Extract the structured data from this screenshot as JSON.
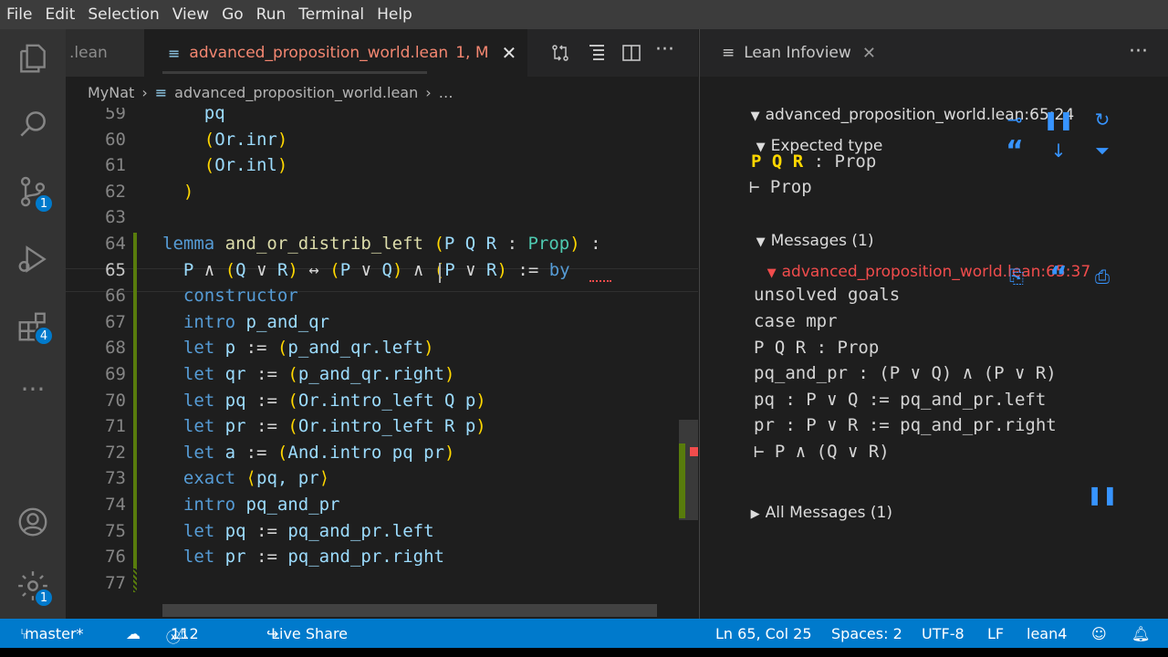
{
  "menu": [
    "File",
    "Edit",
    "Selection",
    "View",
    "Go",
    "Run",
    "Terminal",
    "Help"
  ],
  "activity": {
    "scm_badge": "1",
    "extensions_badge": "4",
    "settings_badge": "1"
  },
  "tabs": {
    "prev": ".lean",
    "active": "advanced_proposition_world.lean",
    "active_status": "1, M"
  },
  "breadcrumb": {
    "folder": "MyNat",
    "file": "advanced_proposition_world.lean",
    "more": "…"
  },
  "code_lines": [
    {
      "n": "59",
      "html": "    <span class='vr'>pq</span>"
    },
    {
      "n": "60",
      "html": "    <span class='br'>(</span><span class='vr'>Or.inr</span><span class='br'>)</span>"
    },
    {
      "n": "61",
      "html": "    <span class='br'>(</span><span class='vr'>Or.inl</span><span class='br'>)</span>"
    },
    {
      "n": "62",
      "html": "  <span class='br'>)</span>"
    },
    {
      "n": "63",
      "html": ""
    },
    {
      "n": "64",
      "html": "<span class='kw'>lemma</span> <span class='fn'>and_or_distrib_left</span> <span class='br'>(</span><span class='vr'>P Q R</span> <span class='pl'>:</span> <span class='ty'>Prop</span><span class='br'>)</span> <span class='pl'>:</span>"
    },
    {
      "n": "65",
      "html": "  <span class='vr'>P</span> <span class='pl'>∧</span> <span class='br'>(</span><span class='vr'>Q</span> <span class='pl'>∨</span> <span class='vr'>R</span><span class='br'>)</span> <span class='pl'>↔</span> <span class='br'>(</span><span class='vr'>P</span> <span class='pl'>∨</span> <span class='vr'>Q</span><span class='br'>)</span> <span class='pl'>∧</span> <span class='br'>(</span><span class='vr'>P</span> <span class='pl'>∨</span> <span class='vr'>R</span><span class='br'>)</span> <span class='pl'>:=</span> <span class='kw'>by</span>"
    },
    {
      "n": "66",
      "html": "  <span class='kw'>constructor</span>"
    },
    {
      "n": "67",
      "html": "  <span class='kw'>intro</span> <span class='vr'>p_and_qr</span>"
    },
    {
      "n": "68",
      "html": "  <span class='kw'>let</span> <span class='vr'>p</span> <span class='pl'>:=</span> <span class='br'>(</span><span class='vr'>p_and_qr.left</span><span class='br'>)</span>"
    },
    {
      "n": "69",
      "html": "  <span class='kw'>let</span> <span class='vr'>qr</span> <span class='pl'>:=</span> <span class='br'>(</span><span class='vr'>p_and_qr.right</span><span class='br'>)</span>"
    },
    {
      "n": "70",
      "html": "  <span class='kw'>let</span> <span class='vr'>pq</span> <span class='pl'>:=</span> <span class='br'>(</span><span class='vr'>Or.intro_left Q p</span><span class='br'>)</span>"
    },
    {
      "n": "71",
      "html": "  <span class='kw'>let</span> <span class='vr'>pr</span> <span class='pl'>:=</span> <span class='br'>(</span><span class='vr'>Or.intro_left R p</span><span class='br'>)</span>"
    },
    {
      "n": "72",
      "html": "  <span class='kw'>let</span> <span class='vr'>a</span> <span class='pl'>:=</span> <span class='br'>(</span><span class='vr'>And.intro pq pr</span><span class='br'>)</span>"
    },
    {
      "n": "73",
      "html": "  <span class='kw'>exact</span> <span class='br'>⟨</span><span class='vr'>pq, pr</span><span class='br'>⟩</span>"
    },
    {
      "n": "74",
      "html": "  <span class='kw'>intro</span> <span class='vr'>pq_and_pr</span>"
    },
    {
      "n": "75",
      "html": "  <span class='kw'>let</span> <span class='vr'>pq</span> <span class='pl'>:=</span> <span class='vr'>pq_and_pr.left</span>"
    },
    {
      "n": "76",
      "html": "  <span class='kw'>let</span> <span class='vr'>pr</span> <span class='pl'>:=</span> <span class='vr'>pq_and_pr.right</span>"
    },
    {
      "n": "77",
      "html": ""
    }
  ],
  "infoview": {
    "title": "Lean Infoview",
    "location": "advanced_proposition_world.lean:65:24",
    "expected_type": "Expected type",
    "goal_vars": "P Q R",
    "goal_vars_type": ": Prop",
    "goal_target": "⊢ Prop",
    "messages": "Messages (1)",
    "msg_location": "advanced_proposition_world.lean:65:37",
    "msg_lines": [
      "unsolved goals",
      "case mpr",
      "P Q R : Prop",
      "pq_and_pr : (P ∨ Q) ∧ (P ∨ R)",
      "pq : P ∨ Q := pq_and_pr.left",
      "pr : P ∨ R := pq_and_pr.right",
      "⊢ P ∧ (Q ∨ R)"
    ],
    "all_messages": "All Messages (1)"
  },
  "status": {
    "branch": "master*",
    "errors": "1",
    "warnings": "12",
    "live_share": "Live Share",
    "position": "Ln 65, Col 25",
    "spaces": "Spaces: 2",
    "encoding": "UTF-8",
    "eol": "LF",
    "language": "lean4"
  },
  "colors": {
    "accent": "#007acc",
    "error": "#f14c4c",
    "active_tab_text": "#f48771"
  }
}
